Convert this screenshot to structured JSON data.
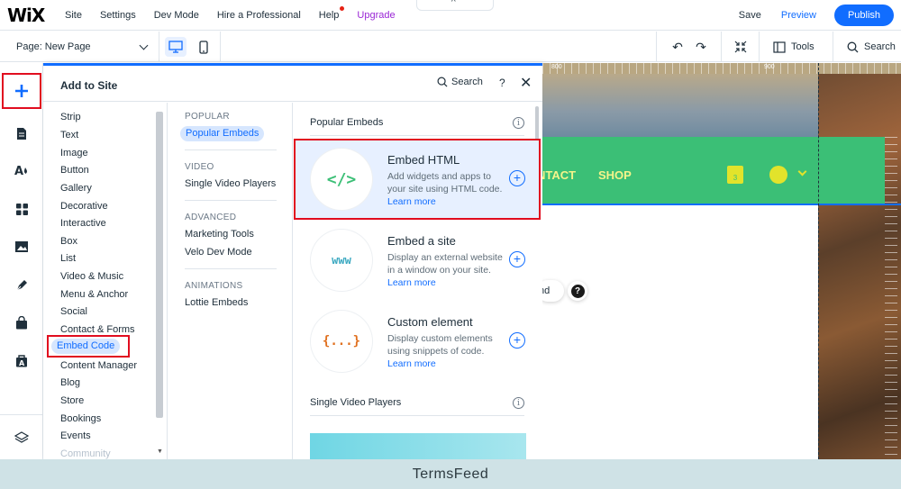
{
  "topbar": {
    "logo": "WiX",
    "nav": [
      "Site",
      "Settings",
      "Dev Mode",
      "Hire a Professional",
      "Help",
      "Upgrade"
    ],
    "save": "Save",
    "preview": "Preview",
    "publish": "Publish",
    "collapse": "^"
  },
  "subbar": {
    "page": "Page: New Page",
    "tools": "Tools",
    "search": "Search"
  },
  "panel": {
    "title": "Add to Site",
    "search": "Search",
    "help": "?",
    "close": "✕",
    "categories": [
      "Strip",
      "Text",
      "Image",
      "Button",
      "Gallery",
      "Decorative",
      "Interactive",
      "Box",
      "List",
      "Video & Music",
      "Menu & Anchor",
      "Social",
      "Contact & Forms",
      "Embed Code",
      "Content Manager",
      "Blog",
      "Store",
      "Bookings",
      "Events",
      "Community"
    ],
    "sections": {
      "popular_title": "POPULAR",
      "popular_items": [
        "Popular Embeds"
      ],
      "video_title": "VIDEO",
      "video_items": [
        "Single Video Players"
      ],
      "advanced_title": "ADVANCED",
      "advanced_items": [
        "Marketing Tools",
        "Velo Dev Mode"
      ],
      "animations_title": "ANIMATIONS",
      "animations_items": [
        "Lottie Embeds"
      ]
    },
    "popular_embeds_heading": "Popular Embeds",
    "single_video_heading": "Single Video Players",
    "info": "i",
    "cards": [
      {
        "icon": "</>",
        "title": "Embed HTML",
        "desc": "Add widgets and apps to your site using HTML code.",
        "link": "Learn more"
      },
      {
        "icon": "www",
        "title": "Embed a site",
        "desc": "Display an external website in a window on your site.",
        "link": "Learn more"
      },
      {
        "icon": "{...}",
        "title": "Custom element",
        "desc": "Display custom elements using snippets of code.",
        "link": "Learn more"
      }
    ]
  },
  "canvas": {
    "ruler": [
      "800",
      "900"
    ],
    "nav_contact": "NTACT",
    "nav_shop": "SHOP",
    "bag_count": "3",
    "pill_text": "nd",
    "question": "?"
  },
  "footer": {
    "text": "TermsFeed"
  },
  "colors": {
    "accent": "#116dff",
    "highlight_frame": "#e10d1f",
    "site_green": "#3bbf76",
    "upgrade_purple": "#9a27d5"
  }
}
